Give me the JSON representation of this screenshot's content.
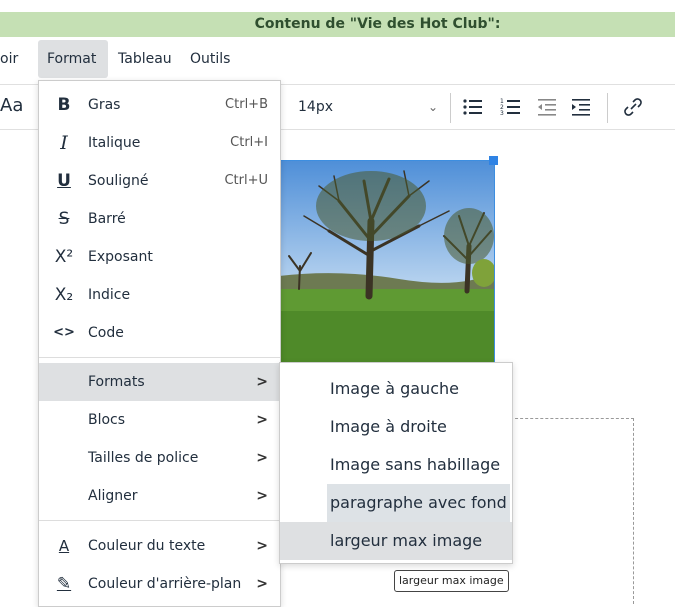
{
  "title_bar": {
    "text": "Contenu de \"Vie des Hot Club\":"
  },
  "menubar": {
    "items": [
      "oir",
      "Format",
      "Tableau",
      "Outils"
    ]
  },
  "toolbar": {
    "aa_label": "Aa",
    "font_size": "14px"
  },
  "format_menu": {
    "items": [
      {
        "icon": "bold-icon",
        "glyph": "B",
        "label": "Gras",
        "shortcut": "Ctrl+B"
      },
      {
        "icon": "italic-icon",
        "glyph": "I",
        "label": "Italique",
        "shortcut": "Ctrl+I"
      },
      {
        "icon": "underline-icon",
        "glyph": "U",
        "label": "Souligné",
        "shortcut": "Ctrl+U"
      },
      {
        "icon": "strikethrough-icon",
        "glyph": "S",
        "label": "Barré",
        "shortcut": ""
      },
      {
        "icon": "superscript-icon",
        "glyph": "X²",
        "label": "Exposant",
        "shortcut": ""
      },
      {
        "icon": "subscript-icon",
        "glyph": "X₂",
        "label": "Indice",
        "shortcut": ""
      },
      {
        "icon": "code-icon",
        "glyph": "<>",
        "label": "Code",
        "shortcut": ""
      },
      {
        "label": "Formats",
        "submenu": true,
        "highlighted": true
      },
      {
        "label": "Blocs",
        "submenu": true
      },
      {
        "label": "Tailles de police",
        "submenu": true
      },
      {
        "label": "Aligner",
        "submenu": true
      },
      {
        "icon": "text-color-icon",
        "glyph": "A",
        "label": "Couleur du texte",
        "submenu": true
      },
      {
        "icon": "highlight-color-icon",
        "glyph": "✎",
        "label": "Couleur d'arrière-plan",
        "submenu": true
      }
    ]
  },
  "formats_submenu": {
    "items": [
      {
        "label": "Image à gauche"
      },
      {
        "label": "Image à droite"
      },
      {
        "label": "Image sans habillage"
      },
      {
        "label": "paragraphe avec fond"
      },
      {
        "label": "largeur max image",
        "highlighted": true
      }
    ]
  },
  "tooltip": {
    "text": "largeur max image"
  },
  "colors": {
    "accent": "#2f83e4",
    "title_bg": "#c5e0b4",
    "highlight": "#dee0e2"
  }
}
